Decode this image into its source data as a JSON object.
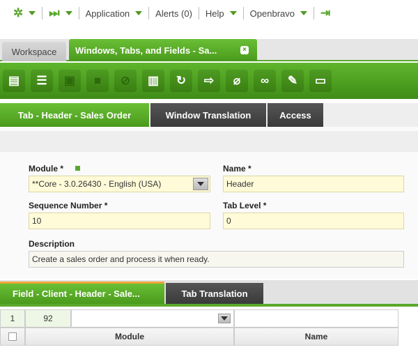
{
  "topnav": {
    "application": "Application",
    "alerts": "Alerts (0)",
    "help": "Help",
    "user": "Openbravo"
  },
  "tabs": {
    "workspace": "Workspace",
    "window": "Windows, Tabs, and Fields - Sa...",
    "close_icon": "×"
  },
  "toolbar": {
    "buttons": [
      "new-document-icon",
      "new-row-icon",
      "save-icon",
      "save-close-icon",
      "undo-icon",
      "delete-icon",
      "refresh-icon",
      "export-icon",
      "attachment-icon",
      "link-icon",
      "tools-icon",
      "form-view-icon"
    ]
  },
  "subtabs": {
    "active": "Tab - Header - Sales Order",
    "translation": "Window Translation",
    "access": "Access"
  },
  "form": {
    "module_label": "Module *",
    "module_value": "**Core - 3.0.26430 - English (USA)",
    "name_label": "Name *",
    "name_value": "Header",
    "sequence_label": "Sequence Number *",
    "sequence_value": "10",
    "tablevel_label": "Tab Level *",
    "tablevel_value": "0",
    "description_label": "Description",
    "description_value": "Create a sales order and process it when ready."
  },
  "bottomtabs": {
    "active": "Field - Client - Header - Sale...",
    "translation": "Tab Translation"
  },
  "grid": {
    "row_num": "1",
    "count": "92",
    "col_module": "Module",
    "col_name": "Name"
  },
  "colors": {
    "accent_green": "#5aa82c",
    "dark_tab": "#3a3a3a",
    "field_yellow": "#fffbd9"
  }
}
